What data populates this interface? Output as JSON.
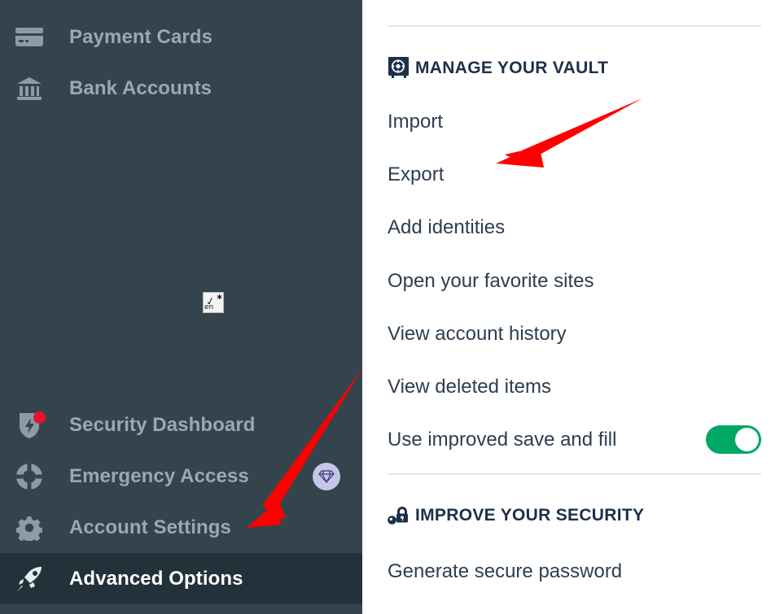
{
  "colors": {
    "sidebar_bg": "#34444c",
    "sidebar_selected_bg": "#22313a",
    "sidebar_label": "#9aa8b0",
    "panel_bg": "#ffffff",
    "heading": "#1c3049",
    "link": "#2d3e50",
    "toggle_on": "#00a865",
    "notification_dot": "#e8112d",
    "premium_badge": "#c6c6e8",
    "annotation_arrow": "#ff0000",
    "divider": "#e3e5e9"
  },
  "sidebar": {
    "items": [
      {
        "label": "Payment Cards",
        "icon": "credit-card-icon",
        "selected": false,
        "badge": null,
        "notification": false
      },
      {
        "label": "Bank Accounts",
        "icon": "bank-icon",
        "selected": false,
        "badge": null,
        "notification": false
      },
      {
        "label": "Security Dashboard",
        "icon": "shield-bolt-icon",
        "selected": false,
        "badge": null,
        "notification": true
      },
      {
        "label": "Emergency Access",
        "icon": "life-preserver-icon",
        "selected": false,
        "badge": "diamond-icon",
        "notification": false
      },
      {
        "label": "Account Settings",
        "icon": "gear-icon",
        "selected": false,
        "badge": null,
        "notification": false
      },
      {
        "label": "Advanced Options",
        "icon": "rocket-icon",
        "selected": true,
        "badge": null,
        "notification": false
      }
    ]
  },
  "ime_indicator": {
    "language": "en",
    "icon": "ime-handwriting-icon"
  },
  "panel": {
    "sections": [
      {
        "title": "MANAGE YOUR VAULT",
        "icon": "safe-vault-icon",
        "links": [
          "Import",
          "Export",
          "Add identities",
          "Open your favorite sites",
          "View account history",
          "View deleted items"
        ],
        "toggle": {
          "label": "Use improved save and fill",
          "state": "on"
        }
      },
      {
        "title": "IMPROVE YOUR SECURITY",
        "icon": "key-lock-icon",
        "links": [
          "Generate secure password"
        ]
      }
    ]
  },
  "annotations": [
    {
      "name": "arrow-pointing-to-export",
      "target": "Export"
    },
    {
      "name": "arrow-pointing-to-account-settings",
      "target": "Account Settings"
    }
  ]
}
